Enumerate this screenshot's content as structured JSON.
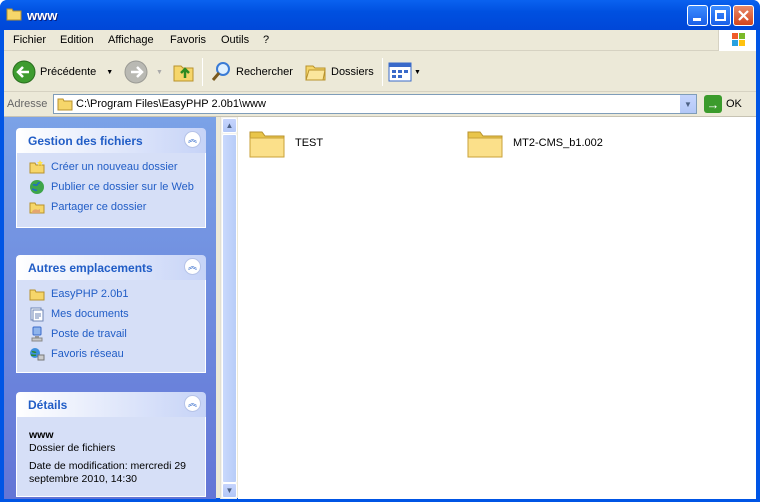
{
  "window": {
    "title": "www"
  },
  "menu": [
    "Fichier",
    "Edition",
    "Affichage",
    "Favoris",
    "Outils",
    "?"
  ],
  "toolbar": {
    "back_label": "Précédente",
    "search_label": "Rechercher",
    "folders_label": "Dossiers"
  },
  "address": {
    "label": "Adresse",
    "value": "C:\\Program Files\\EasyPHP 2.0b1\\www",
    "go_label": "OK"
  },
  "tasks": {
    "title": "Gestion des fichiers",
    "items": [
      "Créer un nouveau dossier",
      "Publier ce dossier sur le Web",
      "Partager ce dossier"
    ]
  },
  "places": {
    "title": "Autres emplacements",
    "items": [
      "EasyPHP 2.0b1",
      "Mes documents",
      "Poste de travail",
      "Favoris réseau"
    ]
  },
  "details": {
    "title": "Détails",
    "name": "www",
    "type": "Dossier de fichiers",
    "modified": "Date de modification: mercredi 29 septembre 2010, 14:30"
  },
  "files": [
    "TEST",
    "MT2-CMS_b1.002"
  ],
  "colors": {
    "title_bar": "#0055e5",
    "task_pane": "#6d8ee0",
    "link": "#215dc6"
  }
}
